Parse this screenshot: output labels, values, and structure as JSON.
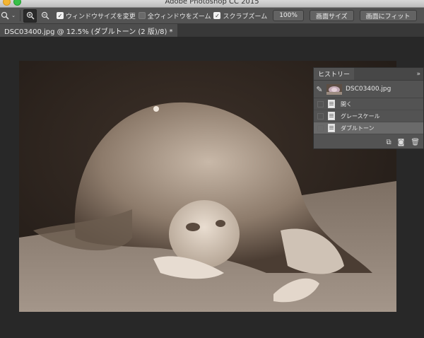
{
  "app": {
    "title": "Adobe Photoshop CC 2015"
  },
  "options_bar": {
    "tool_icon": "zoom-tool-icon",
    "zoom_in_icon": "zoom-in-icon",
    "zoom_out_icon": "zoom-out-icon",
    "resize_windows": {
      "label": "ウィンドウサイズを変更",
      "checked": true
    },
    "zoom_all_windows": {
      "label": "全ウィンドウをズーム",
      "checked": false
    },
    "scrubby_zoom": {
      "label": "スクラブズーム",
      "checked": true
    },
    "zoom_100_button": "100%",
    "fit_screen_button": "画面サイズ",
    "fill_screen_button": "画面にフィット"
  },
  "document_tab": {
    "label": "DSC03400.jpg @ 12.5% (ダブルトーン (2 版)/8) *"
  },
  "history_panel": {
    "tab_label": "ヒストリー",
    "menu_icon": "»",
    "snapshot": {
      "label": "DSC03400.jpg",
      "brush_icon": "history-brush-icon"
    },
    "items": [
      {
        "label": "開く",
        "selected": false
      },
      {
        "label": "グレースケール",
        "selected": false
      },
      {
        "label": "ダブルトーン",
        "selected": true
      }
    ],
    "footer_icons": [
      "new-document-from-state-icon",
      "camera-snapshot-icon",
      "trash-icon"
    ]
  },
  "image": {
    "description_colors": {
      "tone": "#8a7a6c",
      "dark": "#2a221d",
      "light": "#d9cfc4"
    }
  }
}
